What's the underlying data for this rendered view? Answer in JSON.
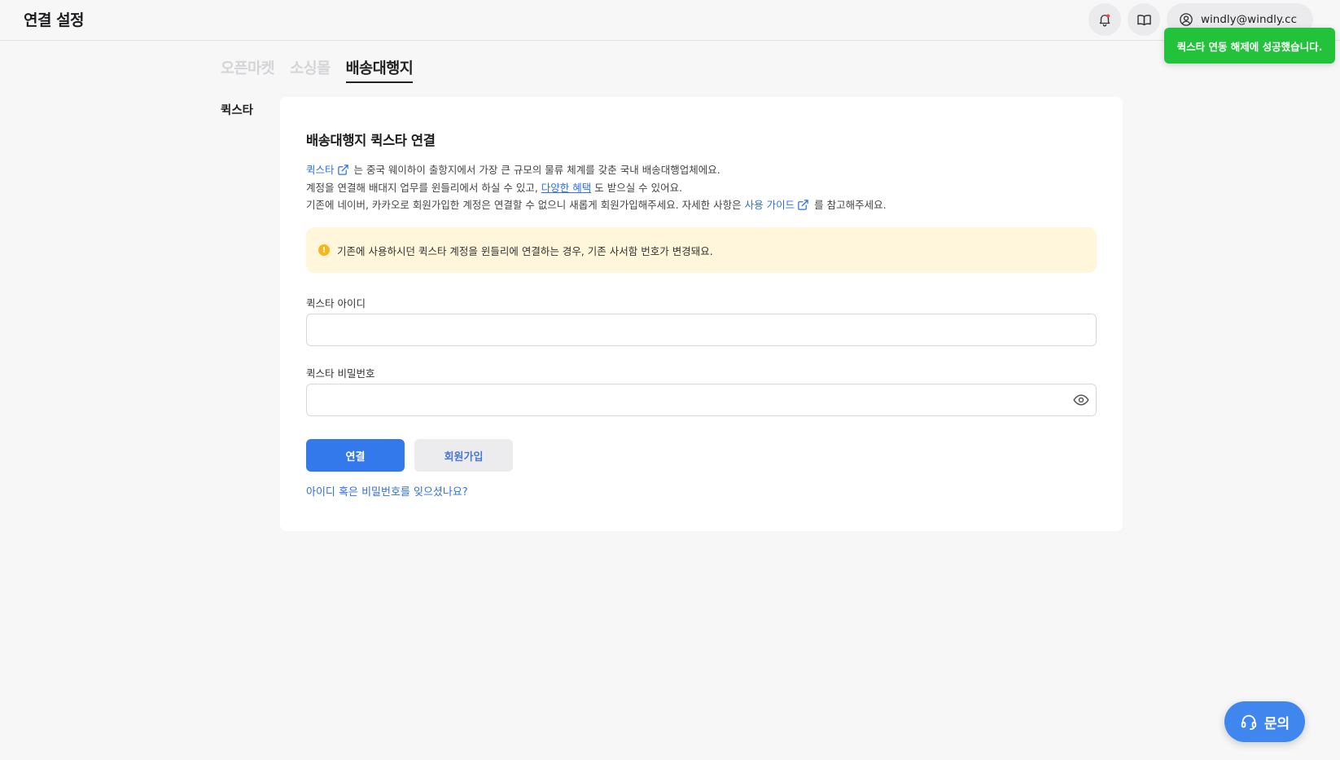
{
  "header": {
    "title": "연결 설정",
    "notification_icon": "bell-icon",
    "guide_icon": "book-icon",
    "account_icon": "user-circle-icon",
    "account_email": "windly@windly.cc"
  },
  "toast": {
    "message": "퀵스타 연동 해제에 성공했습니다."
  },
  "tabs": [
    {
      "label": "오픈마켓",
      "active": false
    },
    {
      "label": "소싱몰",
      "active": false
    },
    {
      "label": "배송대행지",
      "active": true
    }
  ],
  "sidebar": {
    "label": "퀵스타"
  },
  "card": {
    "title": "배송대행지 퀵스타 연결",
    "line1": {
      "link": "퀵스타",
      "text": " 는 중국 웨이하이 출항지에서 가장 큰 규모의 물류 체계를 갖춘 국내 배송대행업체에요."
    },
    "line2": {
      "text_before": "계정을 연결해 배대지 업무를 윈들리에서 하실 수 있고, ",
      "link": "다양한 혜택",
      "text_after": " 도 받으실 수 있어요."
    },
    "line3": {
      "text_before": "기존에 네이버, 카카오로 회원가입한 계정은 연결할 수 없으니 새롭게 회원가입해주세요. 자세한 사항은 ",
      "link": "사용 가이드",
      "text_after": " 를 참고해주세요."
    },
    "notice": "기존에 사용하시던 퀵스타 계정을 윈들리에 연결하는 경우, 기존 사서함 번호가 변경돼요.",
    "notice_icon": "!",
    "id_label": "퀵스타 아이디",
    "id_value": "",
    "password_label": "퀵스타 비밀번호",
    "password_value": "",
    "connect_button": "연결",
    "signup_button": "회원가입",
    "forgot_link": "아이디 혹은 비밀번호를 잊으셨나요?"
  },
  "contact_button": {
    "label": "문의",
    "icon": "headset-icon"
  },
  "colors": {
    "primary": "#3479ec",
    "link": "#2f6fe0",
    "toast": "#22c23a",
    "notice_bg": "#fff6dc",
    "warning": "#f5b81c"
  }
}
